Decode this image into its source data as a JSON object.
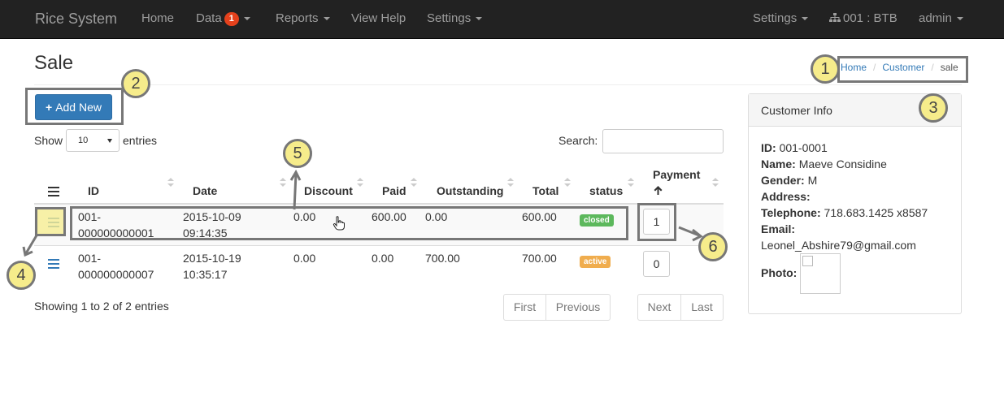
{
  "navbar": {
    "brand": "Rice System",
    "items": [
      "Home",
      "Data",
      "Reports",
      "View Help",
      "Settings"
    ],
    "data_badge": "1",
    "right_items": [
      "Settings",
      "001 : BTB",
      "admin"
    ]
  },
  "page": {
    "title": "Sale"
  },
  "breadcrumb": [
    "Home",
    "Customer",
    "sale"
  ],
  "toolbar": {
    "add_label": "Add New"
  },
  "table_controls": {
    "show_label": "Show",
    "page_size": "10",
    "entries_label": "entries",
    "search_label": "Search:"
  },
  "table": {
    "headers": [
      "ID",
      "Date",
      "Discount",
      "Paid",
      "Outstanding",
      "Total",
      "status",
      "Payment"
    ],
    "rows": [
      {
        "id_1": "001-",
        "id_2": "000000000001",
        "date_1": "2015-10-09",
        "date_2": "09:14:35",
        "discount": "0.00",
        "paid": "600.00",
        "outstanding": "0.00",
        "total": "600.00",
        "status": "closed",
        "payment": "1"
      },
      {
        "id_1": "001-",
        "id_2": "000000000007",
        "date_1": "2015-10-19",
        "date_2": "10:35:17",
        "discount": "0.00",
        "paid": "0.00",
        "outstanding": "700.00",
        "total": "700.00",
        "status": "active",
        "payment": "0"
      }
    ]
  },
  "footer": {
    "showing": "Showing 1 to 2 of 2 entries"
  },
  "pagination": [
    "First",
    "Previous",
    "Next",
    "Last"
  ],
  "customer": {
    "panel_title": "Customer Info",
    "fields": [
      {
        "label": "ID:",
        "value": "001-0001"
      },
      {
        "label": "Name:",
        "value": "Maeve Considine"
      },
      {
        "label": "Gender:",
        "value": "M"
      },
      {
        "label": "Address:",
        "value": ""
      },
      {
        "label": "Telephone:",
        "value": "718.683.1425 x8587"
      },
      {
        "label": "Email:",
        "value": ""
      }
    ],
    "email": "Leonel_Abshire79@gmail.com",
    "photo_label": "Photo:"
  },
  "annotations": [
    "1",
    "2",
    "3",
    "4",
    "5",
    "6"
  ],
  "colors": {
    "primary": "#337ab7",
    "success": "#5cb85c",
    "warning": "#f0ad4e",
    "badge": "#e5411c",
    "callout": "#f6ec8b"
  }
}
